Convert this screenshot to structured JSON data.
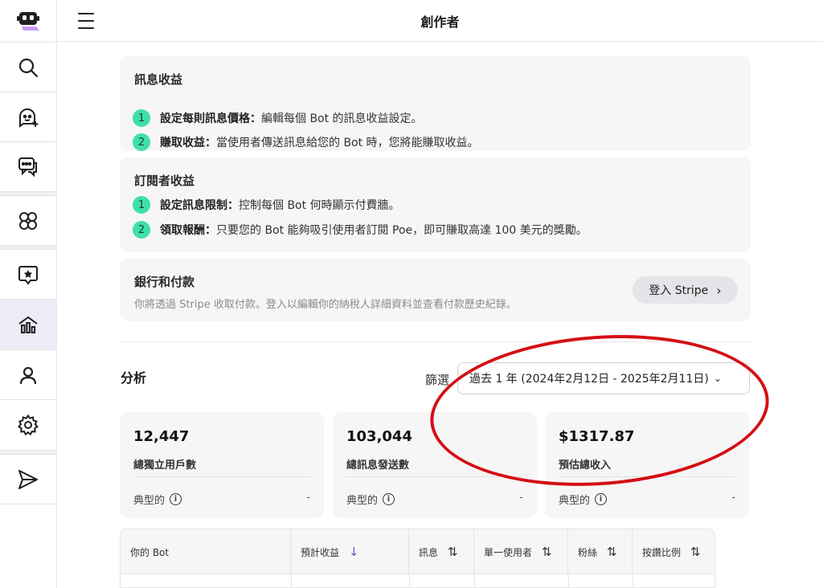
{
  "header": {
    "title": "創作者"
  },
  "message_earnings": {
    "title": "訊息收益",
    "steps": [
      {
        "num": "1",
        "bold": "設定每則訊息價格：",
        "text": " 編輯每個 Bot 的訊息收益設定。"
      },
      {
        "num": "2",
        "bold": "賺取收益：",
        "text": "當使用者傳送訊息給您的 Bot 時，您將能賺取收益。"
      }
    ]
  },
  "subscriber_earnings": {
    "title": "訂閱者收益",
    "steps": [
      {
        "num": "1",
        "bold": "設定訊息限制：",
        "text": "控制每個 Bot 何時顯示付費牆。"
      },
      {
        "num": "2",
        "bold": "領取報酬：",
        "text": "只要您的 Bot 能夠吸引使用者訂閱 Poe，即可賺取高達 100 美元的獎勵。"
      }
    ]
  },
  "bank": {
    "title": "銀行和付款",
    "subtitle": "你將透過 Stripe 收取付款。登入以編輯你的納稅人詳細資料並查看付款歷史紀錄。",
    "button_label": "登入 Stripe"
  },
  "analysis": {
    "title": "分析",
    "filter_label": "篩選",
    "filter_value": "過去 1 年 (2024年2月12日 - 2025年2月11日)",
    "stats": [
      {
        "value": "12,447",
        "label": "總獨立用戶數",
        "typical": "典型的",
        "dash": "-"
      },
      {
        "value": "103,044",
        "label": "總訊息發送數",
        "typical": "典型的",
        "dash": "-"
      },
      {
        "value": "$1317.87",
        "label": "預估總收入",
        "typical": "典型的",
        "dash": "-"
      }
    ]
  },
  "table": {
    "headers": [
      "你的 Bot",
      "預計收益",
      "訊息",
      "單一使用者",
      "粉絲",
      "按讚比例"
    ]
  },
  "annotation_color": "#d40f15",
  "accent_color": "#3ee0a6"
}
